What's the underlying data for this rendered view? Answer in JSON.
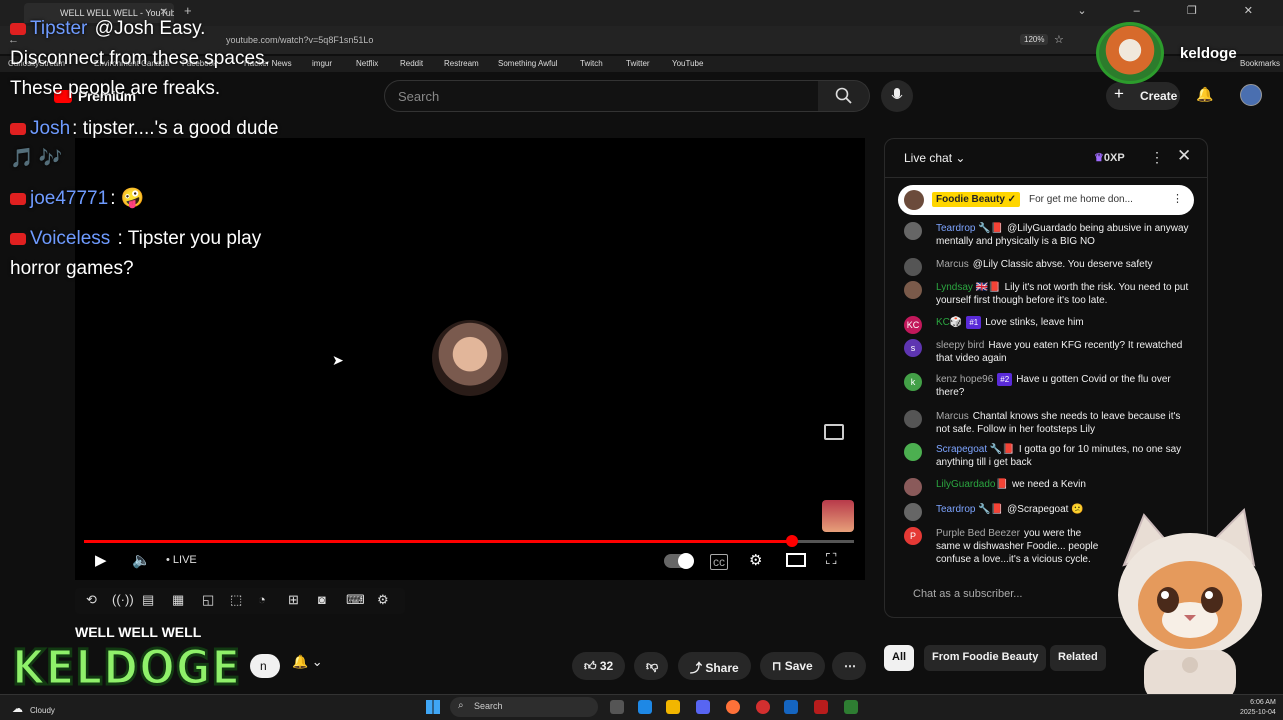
{
  "browser": {
    "tab_title": "WELL WELL WELL - YouTube",
    "url": "youtube.com/watch?v=5q8F1sn51Lo",
    "zoom": "120%",
    "bookmarks": [
      "CuriosityStream",
      "Environment Canada",
      "Facebook",
      "Hacker News",
      "imgur",
      "Netflix",
      "Reddit",
      "Restream",
      "Something Awful",
      "Twitch",
      "Twitter",
      "YouTube"
    ],
    "bookmarks_right": "Bookmarks"
  },
  "header": {
    "logo_text": "Premium",
    "search_placeholder": "Search",
    "create_label": "Create"
  },
  "overlay_chat": [
    {
      "name": "Tipster",
      "text": "@Josh Easy. Disconnect from these spaces. These people are freaks."
    },
    {
      "name": "Josh",
      "text": "tipster....'s a good dude 🎵 🎶"
    },
    {
      "name": "joe47771",
      "text": "🤪"
    },
    {
      "name": "Voiceless",
      "text": "Tipster you play horror games?"
    }
  ],
  "player": {
    "live_label": "LIVE",
    "progress": 0.92
  },
  "video": {
    "title": "WELL WELL WELL",
    "like_count": "32",
    "share_label": "Share",
    "save_label": "Save",
    "subscribe_fragment": "n"
  },
  "overlay_branding": {
    "channel_logo_text": "KELDOGE",
    "streamer_name": "keldoge"
  },
  "chat": {
    "title": "Live chat",
    "xp": "0XP",
    "pinned": {
      "name": "Foodie Beauty ✓",
      "text": "For get me home don..."
    },
    "messages": [
      {
        "name": "Teardrop 🔧📕",
        "color": "blue",
        "avatar": "",
        "badge": "",
        "text": "@LilyGuardado being abusive in anyway mentally and physically is a BIG NO"
      },
      {
        "name": "Marcus",
        "color": "gray",
        "avatar": "",
        "badge": "",
        "text": "@Lily Classic abvse. You deserve safety"
      },
      {
        "name": "Lyndsay 🇬🇧📕",
        "color": "green",
        "avatar": "",
        "badge": "",
        "text": "Lily it's not worth the risk. You need to put yourself first though before it's too late."
      },
      {
        "name": "KC🎲",
        "color": "green",
        "avatar": "KC",
        "badge": "#1",
        "text": "Love stinks, leave him"
      },
      {
        "name": "sleepy bird",
        "color": "gray",
        "avatar": "s",
        "badge": "",
        "text": "Have you eaten KFG recently? It rewatched that video again"
      },
      {
        "name": "kenz hope96",
        "color": "gray",
        "avatar": "k",
        "badge": "#2",
        "text": "Have u gotten Covid or the flu over there?"
      },
      {
        "name": "Marcus",
        "color": "gray",
        "avatar": "",
        "badge": "",
        "text": "Chantal knows she needs to leave because it's not safe. Follow in her footsteps Lily"
      },
      {
        "name": "Scrapegoat 🔧📕",
        "color": "blue",
        "avatar": "",
        "badge": "",
        "text": "I gotta go for 10 minutes, no one say anything till i get back"
      },
      {
        "name": "LilyGuardado📕",
        "color": "green",
        "avatar": "",
        "badge": "",
        "text": "we need a Kevin"
      },
      {
        "name": "Teardrop 🔧📕",
        "color": "blue",
        "avatar": "",
        "badge": "",
        "text": "@Scrapegoat 😕"
      },
      {
        "name": "Purple Bed Beezer",
        "color": "gray",
        "avatar": "P",
        "badge": "",
        "text": "you were the same w dishwasher Foodie... people confuse a love...it's a vicious cycle."
      }
    ],
    "input_placeholder": "Chat as a subscriber..."
  },
  "related_chips": [
    "All",
    "From Foodie Beauty",
    "Related"
  ],
  "taskbar": {
    "weather": "Cloudy",
    "search_label": "Search",
    "time": "6:06 AM",
    "date": "2025-10-04"
  },
  "colors": {
    "accent": "#ff0000",
    "link_blue": "#6f9bff",
    "brand_green": "#8ff06a"
  }
}
